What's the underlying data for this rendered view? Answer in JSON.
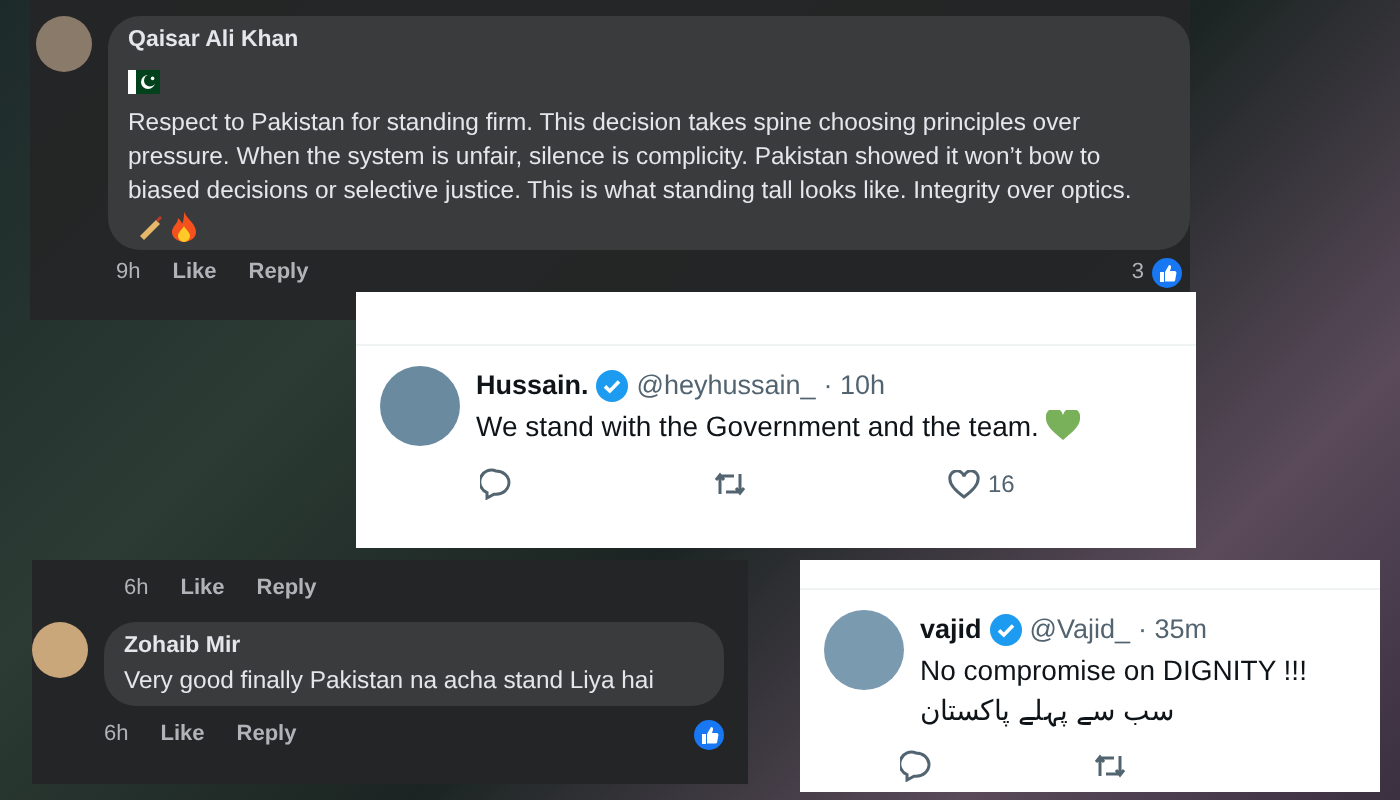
{
  "facebook_comments": [
    {
      "author": "Qaisar Ali Khan",
      "flag": true,
      "text": "Respect to Pakistan for standing firm. This decision takes spine choosing principles over pressure. When the system is unfair, silence is complicity. Pakistan showed it won’t bow to biased decisions or selective justice. This is what standing tall looks like. Integrity over optics.",
      "time": "9h",
      "actions": [
        "Like",
        "Reply"
      ],
      "reaction_count": "3"
    },
    {
      "author": "Zohaib Mir",
      "flag": false,
      "text": "Very good finally Pakistan na acha stand Liya hai",
      "time": "6h",
      "actions": [
        "Like",
        "Reply"
      ],
      "previous_meta": {
        "time": "6h",
        "actions": [
          "Like",
          "Reply"
        ]
      }
    }
  ],
  "tweets": [
    {
      "author": "Hussain.",
      "verified": true,
      "handle": "@heyhussain_",
      "time": "· 10h",
      "lines": [
        "We stand with the Government and the team."
      ],
      "heart": true,
      "likes": "16"
    },
    {
      "author": "vajid",
      "verified": true,
      "handle": "@Vajid_",
      "time": "· 35m",
      "lines": [
        "No compromise on DIGNITY !!!",
        "سب سے پہلے پاکستان"
      ],
      "heart": false
    }
  ]
}
